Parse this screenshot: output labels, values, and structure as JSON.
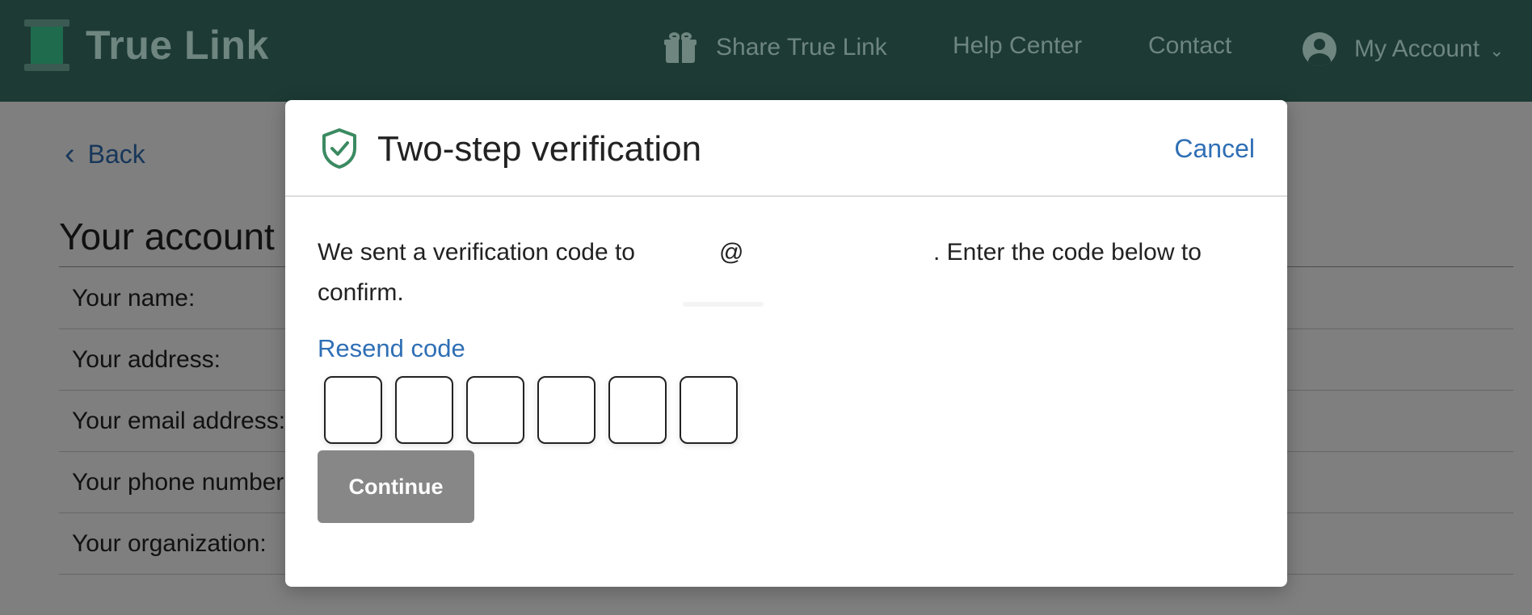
{
  "nav": {
    "brand": "True Link",
    "share": "Share True Link",
    "help": "Help Center",
    "contact": "Contact",
    "account": "My Account",
    "icons": {
      "share": "gift-icon",
      "account": "user-icon",
      "account_caret": "chevron-down-icon"
    }
  },
  "background": {
    "back": "Back",
    "title": "Your account",
    "rows": [
      "Your name:",
      "Your address:",
      "Your email address:",
      "Your phone number:",
      "Your organization:"
    ]
  },
  "modal": {
    "title": "Two-step verification",
    "cancel": "Cancel",
    "message_start": "We sent a verification code to",
    "message_at": "@",
    "message_end": ". Enter the code below to",
    "message_line2": "confirm.",
    "resend": "Resend code",
    "code_digits": [
      "",
      "",
      "",
      "",
      "",
      ""
    ],
    "continue": "Continue",
    "icons": {
      "title": "shield-check-icon"
    }
  },
  "colors": {
    "nav_bg": "#1d3a34",
    "nav_text": "#6e8580",
    "link": "#2f6fb5",
    "shield": "#3b8a62",
    "button_disabled": "#878787"
  }
}
